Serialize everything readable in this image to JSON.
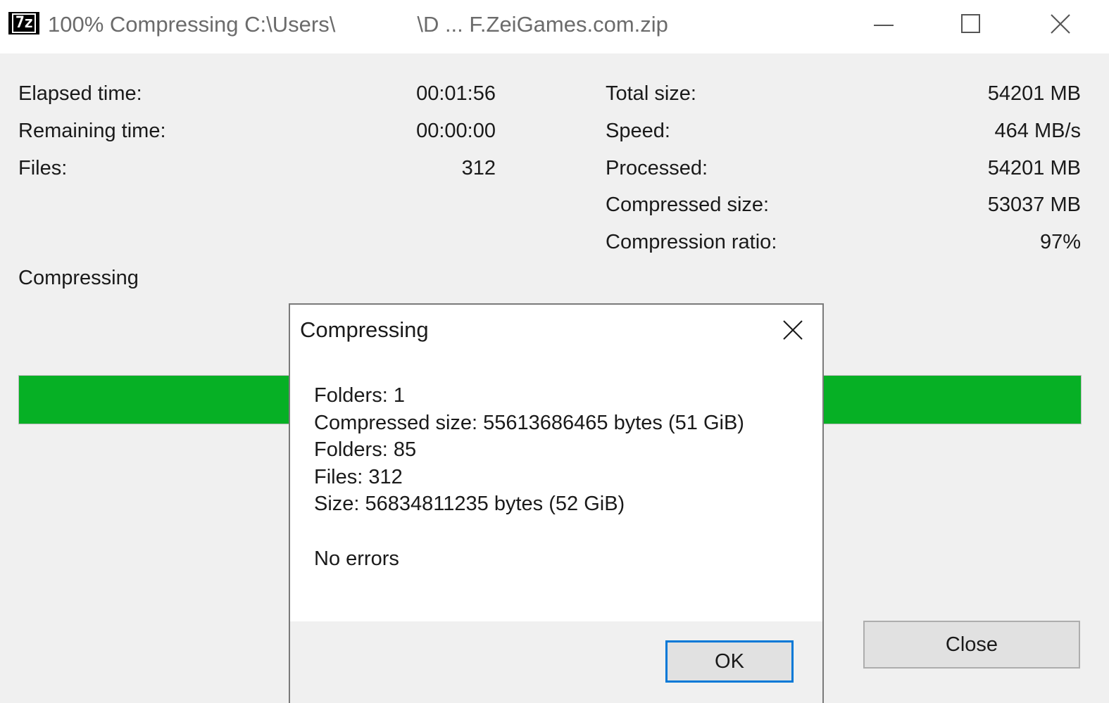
{
  "window": {
    "title_prefix": "100% Compressing C:\\Users\\",
    "title_suffix": "\\D ... F.ZeiGames.com.zip",
    "app_icon_text": "7z",
    "controls": {
      "minimize": "minimize-icon",
      "maximize": "maximize-icon",
      "close": "close-icon"
    }
  },
  "stats_left": [
    {
      "label": "Elapsed time:",
      "value": "00:01:56"
    },
    {
      "label": "Remaining time:",
      "value": "00:00:00"
    },
    {
      "label": "Files:",
      "value": "312"
    }
  ],
  "stats_right": [
    {
      "label": "Total size:",
      "value": "54201 MB"
    },
    {
      "label": "Speed:",
      "value": "464 MB/s"
    },
    {
      "label": "Processed:",
      "value": "54201 MB"
    },
    {
      "label": "Compressed size:",
      "value": "53037 MB"
    },
    {
      "label": "Compression ratio:",
      "value": "97%"
    }
  ],
  "status": "Compressing",
  "progress": {
    "percent": 100,
    "color": "#06b025"
  },
  "buttons": {
    "close_label": "Close"
  },
  "dialog": {
    "title": "Compressing",
    "lines": [
      "Folders: 1",
      "Compressed size: 55613686465 bytes (51 GiB)",
      "Folders: 85",
      "Files: 312",
      "Size: 56834811235 bytes (52 GiB)"
    ],
    "result": "No errors",
    "ok_label": "OK"
  },
  "colors": {
    "accent": "#0078d7",
    "progress": "#06b025"
  }
}
